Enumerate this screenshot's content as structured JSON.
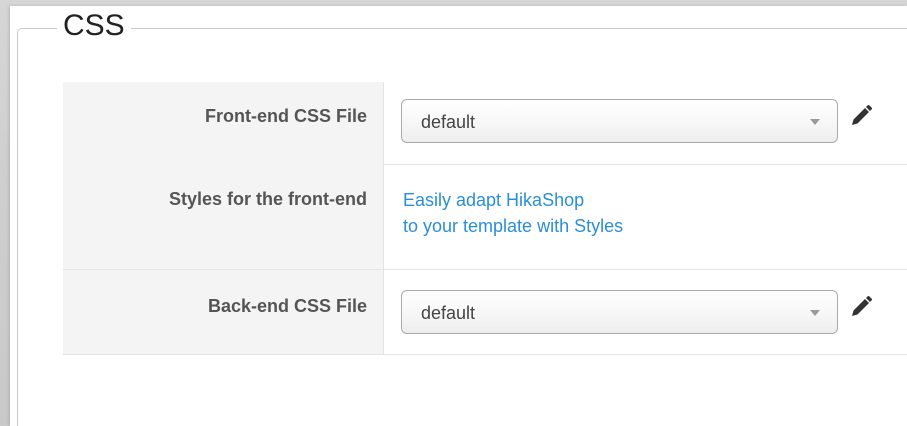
{
  "section": {
    "legend": "CSS"
  },
  "fields": {
    "frontend_css": {
      "label": "Front-end CSS File",
      "value": "default"
    },
    "styles": {
      "label": "Styles for the front-end",
      "link_line1": "Easily adapt HikaShop",
      "link_line2": "to your template with Styles"
    },
    "backend_css": {
      "label": "Back-end CSS File",
      "value": "default"
    }
  },
  "colors": {
    "link": "#2a8fd6",
    "label": "#555555",
    "label_background": "#f4f4f4"
  },
  "icons": {
    "edit": "pencil-icon",
    "dropdown": "dropdown-arrow-icon"
  }
}
